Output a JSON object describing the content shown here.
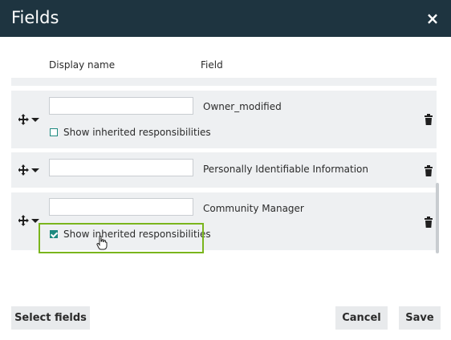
{
  "dialog": {
    "title": "Fields",
    "close_glyph": "×"
  },
  "columns": {
    "display_name": "Display name",
    "field": "Field"
  },
  "rows": [
    {
      "display_value": "",
      "field": "Owner_modified",
      "has_checkbox": true,
      "checkbox_label": "Show inherited responsibilities",
      "checked": false
    },
    {
      "display_value": "",
      "field": "Personally Identifiable Information",
      "has_checkbox": false
    },
    {
      "display_value": "",
      "field": "Community Manager",
      "has_checkbox": true,
      "checkbox_label": "Show inherited responsibilities",
      "checked": true
    }
  ],
  "icons": {
    "drag": "move-arrows-icon",
    "dropdown": "caret-down-icon",
    "delete": "trash-icon",
    "pointer": "hand-pointer-icon"
  },
  "buttons": {
    "select_fields": "Select fields",
    "cancel": "Cancel",
    "save": "Save"
  },
  "colors": {
    "header_bg": "#1e3440",
    "row_bg": "#eef0f2",
    "checkbox": "#1e8a80",
    "highlight": "#7ab51d"
  }
}
